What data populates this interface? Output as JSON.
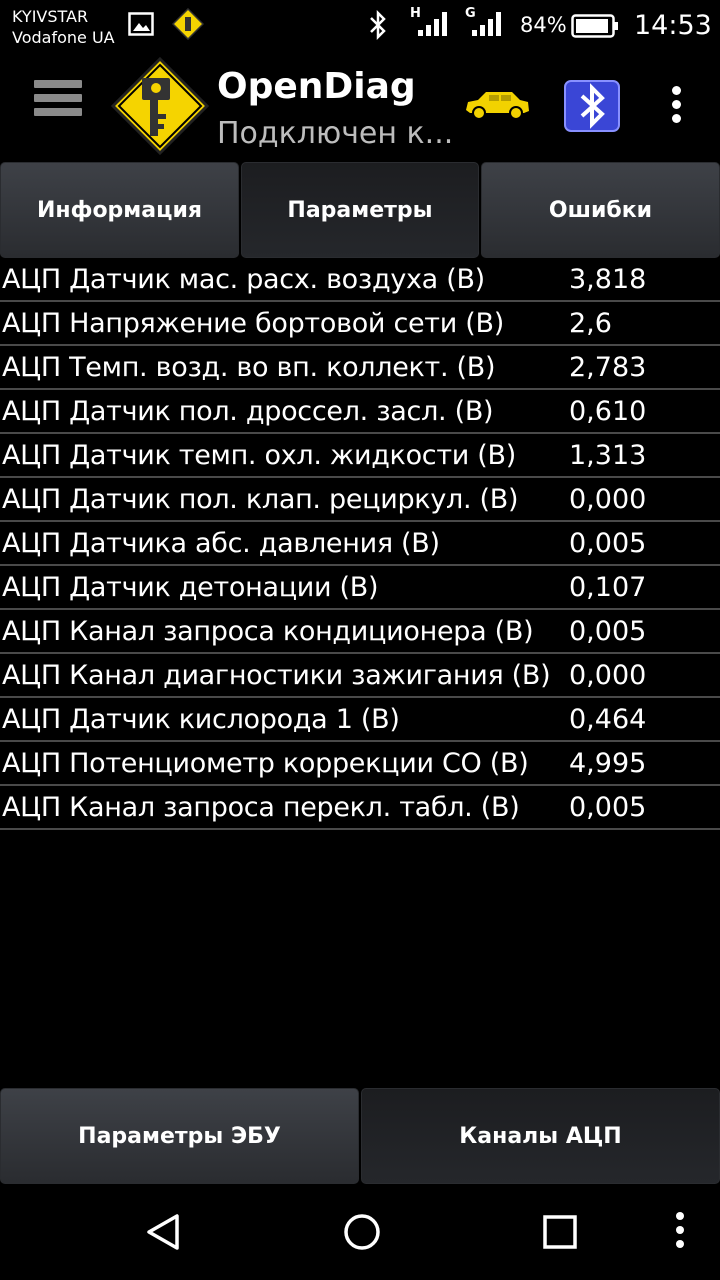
{
  "status_bar": {
    "carrier_line1": "KYIVSTAR",
    "carrier_line2": "Vodafone UA",
    "network1_label": "H",
    "network2_label": "G",
    "battery": "84%",
    "time": "14:53"
  },
  "app_bar": {
    "title": "OpenDiag",
    "subtitle": "Подключен к..."
  },
  "tabs": [
    {
      "label": "Информация",
      "active": false
    },
    {
      "label": "Параметры",
      "active": true
    },
    {
      "label": "Ошибки",
      "active": false
    }
  ],
  "params": [
    {
      "name": "АЦП Датчик мас. расх. воздуха (В)",
      "value": "3,818"
    },
    {
      "name": "АЦП Напряжение бортовой сети (В)",
      "value": "2,6"
    },
    {
      "name": "АЦП Темп. возд. во вп. коллект. (В)",
      "value": "2,783"
    },
    {
      "name": "АЦП Датчик пол. дроссел. засл. (В)",
      "value": "0,610"
    },
    {
      "name": "АЦП Датчик темп. охл. жидкости (В)",
      "value": "1,313"
    },
    {
      "name": "АЦП Датчик пол. клап. рециркул. (В)",
      "value": "0,000"
    },
    {
      "name": "АЦП Датчика абс. давления (В)",
      "value": "0,005"
    },
    {
      "name": "АЦП Датчик детонации (В)",
      "value": "0,107"
    },
    {
      "name": "АЦП Канал запроса кондиционера (В)",
      "value": "0,005"
    },
    {
      "name": "АЦП Канал диагностики зажигания (В)",
      "value": "0,000"
    },
    {
      "name": "АЦП Датчик кислорода 1 (В)",
      "value": "0,464"
    },
    {
      "name": "АЦП Потенциометр коррекции СО (В)",
      "value": "4,995"
    },
    {
      "name": "АЦП Канал запроса перекл. табл. (В)",
      "value": "0,005"
    }
  ],
  "bottom_tabs": [
    {
      "label": "Параметры ЭБУ",
      "active": false
    },
    {
      "label": "Каналы АЦП",
      "active": true
    }
  ],
  "colors": {
    "logo_yellow": "#f5d400",
    "car_yellow": "#f2d200",
    "bluetooth_blue": "#3a46d6"
  }
}
